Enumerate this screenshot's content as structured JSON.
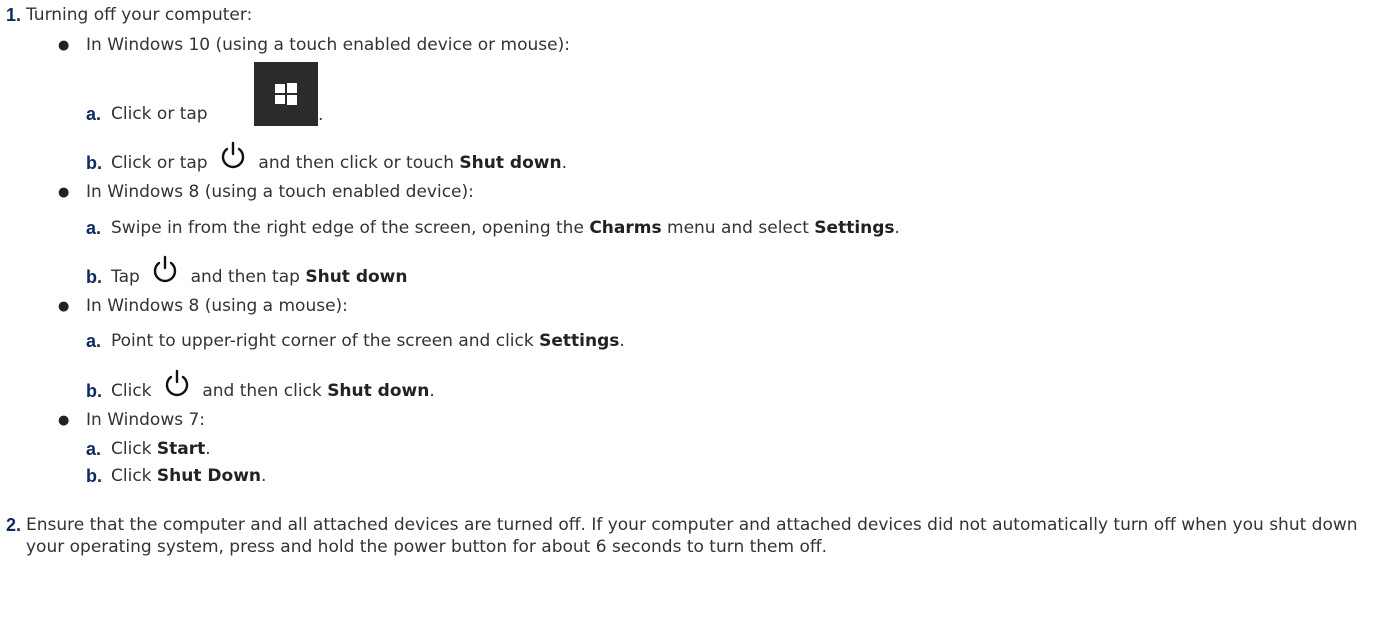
{
  "step1": {
    "number": "1.",
    "text": "Turning off your computer:"
  },
  "win10": {
    "bullet": "●",
    "heading": "In Windows 10 (using a touch enabled device or mouse):",
    "a_label": "a.",
    "a_text": "Click or tap",
    "a_end": ".",
    "b_label": "b.",
    "b_text1": "Click or tap",
    "b_text2": "and then click or touch",
    "b_bold": "Shut down",
    "b_end": "."
  },
  "win8touch": {
    "bullet": "●",
    "heading": "In Windows 8 (using a touch enabled device):",
    "a_label": "a.",
    "a_text1": "Swipe in from the right edge of the screen, opening the",
    "a_bold1": "Charms",
    "a_text2": "menu and select",
    "a_bold2": "Settings",
    "a_end": ".",
    "b_label": "b.",
    "b_text1": "Tap",
    "b_text2": "and then tap",
    "b_bold": "Shut down"
  },
  "win8mouse": {
    "bullet": "●",
    "heading": "In Windows 8 (using a mouse):",
    "a_label": "a.",
    "a_text": "Point to upper-right corner of the screen and click",
    "a_bold": "Settings",
    "a_end": ".",
    "b_label": "b.",
    "b_text1": "Click",
    "b_text2": "and then click",
    "b_bold": "Shut down",
    "b_end": "."
  },
  "win7": {
    "bullet": "●",
    "heading": "In Windows 7:",
    "a_label": "a.",
    "a_text": "Click",
    "a_bold": "Start",
    "a_end": ".",
    "b_label": "b.",
    "b_text": "Click",
    "b_bold": "Shut Down",
    "b_end": "."
  },
  "step2": {
    "number": "2.",
    "text": "Ensure that the computer and all attached devices are turned off. If your computer and attached devices did not automatically turn off when you shut down your operating system, press and hold the power button for about 6 seconds to turn them off."
  },
  "colors": {
    "label_blue": "#0e2a63",
    "text": "#333333",
    "tile": "#2b2b2b"
  },
  "icons": [
    "windows-start-icon",
    "power-icon"
  ]
}
